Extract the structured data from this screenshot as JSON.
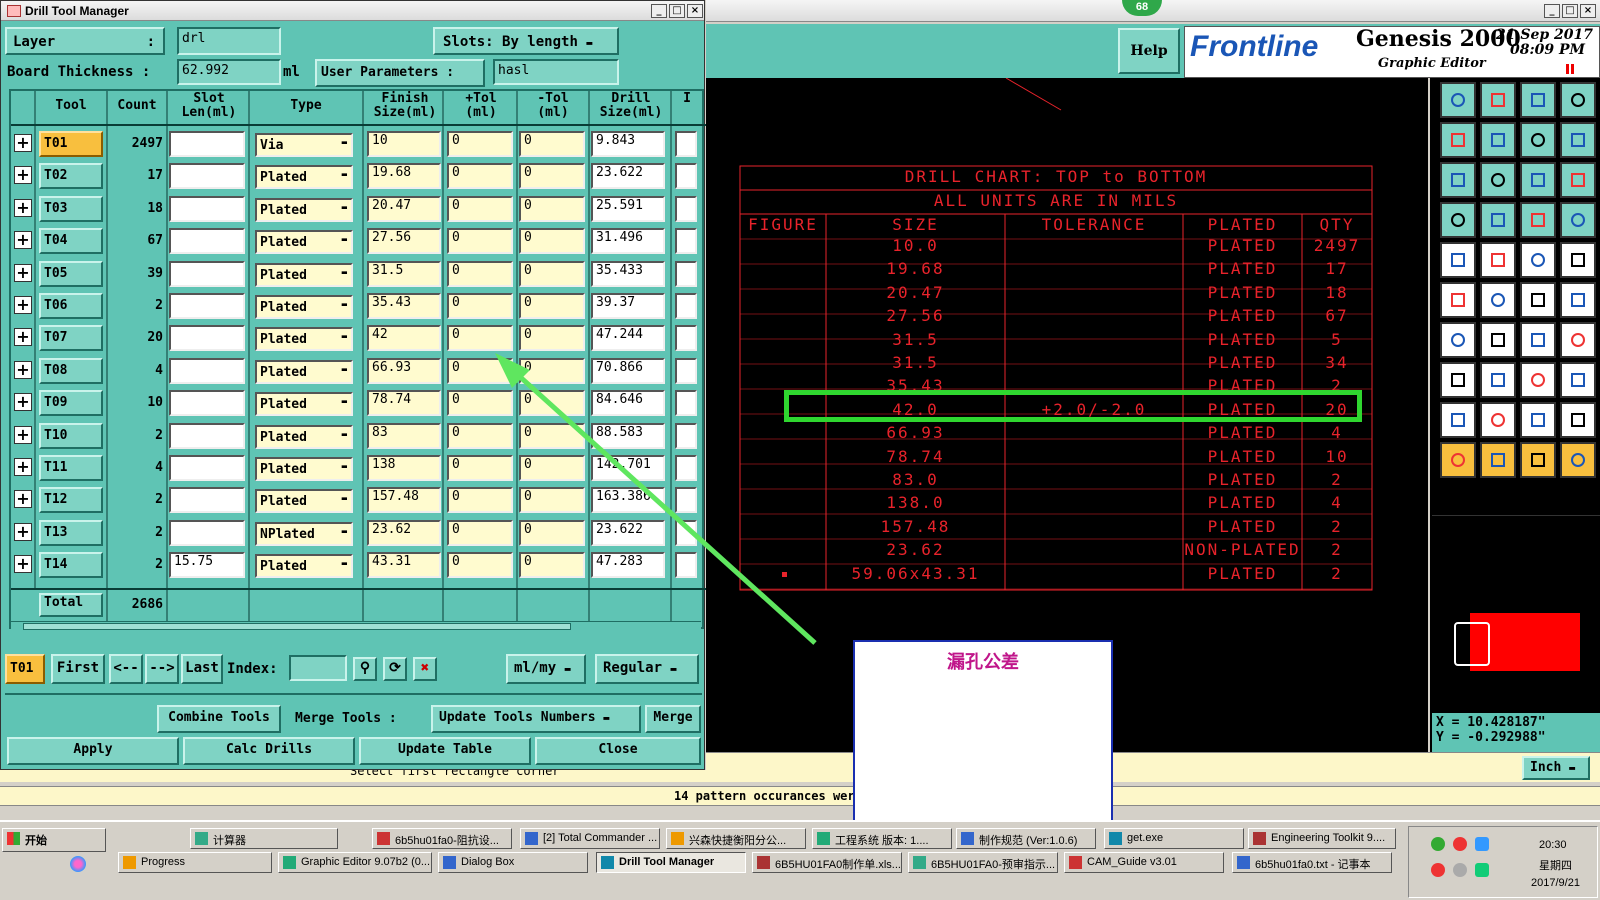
{
  "dtm": {
    "title": "Drill Tool Manager",
    "layer_label": "Layer",
    "layer_sep": ":",
    "layer_value": "drl",
    "slots_label": "Slots:",
    "slots_value": "By length",
    "thickness_label": "Board Thickness :",
    "thickness_value": "62.992",
    "thickness_unit": "ml",
    "user_params_label": "User Parameters :",
    "user_params_value": "hasl",
    "headers": {
      "tool": "Tool",
      "count": "Count",
      "slot": "Slot Len(ml)",
      "type": "Type",
      "finish": "Finish Size(ml)",
      "ptol": "+Tol (ml)",
      "ntol": "-Tol (ml)",
      "drill": "Drill Size(ml)",
      "extra": "I"
    },
    "rows": [
      {
        "tool": "T01",
        "count": "2497",
        "slot": "",
        "type": "Via",
        "finish": "10",
        "ptol": "0",
        "ntol": "0",
        "drill": "9.843"
      },
      {
        "tool": "T02",
        "count": "17",
        "slot": "",
        "type": "Plated",
        "finish": "19.68",
        "ptol": "0",
        "ntol": "0",
        "drill": "23.622"
      },
      {
        "tool": "T03",
        "count": "18",
        "slot": "",
        "type": "Plated",
        "finish": "20.47",
        "ptol": "0",
        "ntol": "0",
        "drill": "25.591"
      },
      {
        "tool": "T04",
        "count": "67",
        "slot": "",
        "type": "Plated",
        "finish": "27.56",
        "ptol": "0",
        "ntol": "0",
        "drill": "31.496"
      },
      {
        "tool": "T05",
        "count": "39",
        "slot": "",
        "type": "Plated",
        "finish": "31.5",
        "ptol": "0",
        "ntol": "0",
        "drill": "35.433"
      },
      {
        "tool": "T06",
        "count": "2",
        "slot": "",
        "type": "Plated",
        "finish": "35.43",
        "ptol": "0",
        "ntol": "0",
        "drill": "39.37"
      },
      {
        "tool": "T07",
        "count": "20",
        "slot": "",
        "type": "Plated",
        "finish": "42",
        "ptol": "0",
        "ntol": "0",
        "drill": "47.244"
      },
      {
        "tool": "T08",
        "count": "4",
        "slot": "",
        "type": "Plated",
        "finish": "66.93",
        "ptol": "0",
        "ntol": "0",
        "drill": "70.866"
      },
      {
        "tool": "T09",
        "count": "10",
        "slot": "",
        "type": "Plated",
        "finish": "78.74",
        "ptol": "0",
        "ntol": "0",
        "drill": "84.646"
      },
      {
        "tool": "T10",
        "count": "2",
        "slot": "",
        "type": "Plated",
        "finish": "83",
        "ptol": "0",
        "ntol": "0",
        "drill": "88.583"
      },
      {
        "tool": "T11",
        "count": "4",
        "slot": "",
        "type": "Plated",
        "finish": "138",
        "ptol": "0",
        "ntol": "0",
        "drill": "142.701"
      },
      {
        "tool": "T12",
        "count": "2",
        "slot": "",
        "type": "Plated",
        "finish": "157.48",
        "ptol": "0",
        "ntol": "0",
        "drill": "163.386"
      },
      {
        "tool": "T13",
        "count": "2",
        "slot": "",
        "type": "NPlated",
        "finish": "23.62",
        "ptol": "0",
        "ntol": "0",
        "drill": "23.622"
      },
      {
        "tool": "T14",
        "count": "2",
        "slot": "15.75",
        "type": "Plated",
        "finish": "43.31",
        "ptol": "0",
        "ntol": "0",
        "drill": "47.283"
      }
    ],
    "total_label": "Total",
    "total_value": "2686",
    "nav": {
      "current": "T01",
      "first": "First",
      "prev": "<--",
      "next": "-->",
      "last": "Last",
      "index_label": "Index:",
      "units": "ml/my",
      "mode": "Regular"
    },
    "actions": {
      "combine": "Combine Tools",
      "merge_label": "Merge Tools :",
      "update_numbers": "Update Tools Numbers",
      "merge": "Merge",
      "apply": "Apply",
      "calc": "Calc Drills",
      "update_table": "Update Table",
      "close": "Close"
    }
  },
  "genesis": {
    "help": "Help",
    "brand": "Frontline",
    "product": "Genesis 2000",
    "subtitle": "Graphic Editor",
    "date": "21 Sep 2017",
    "time": "08:09 PM",
    "badge": "68",
    "coord_x": "X =  10.428187\"",
    "coord_y": "Y = -0.292988\"",
    "units": "Inch",
    "status_msg": "Select first rectangle corner",
    "pattern_msg": "14 pattern occurances were"
  },
  "chart": {
    "title1": "DRILL CHART: TOP to BOTTOM",
    "title2": "ALL UNITS ARE IN MILS",
    "headers": [
      "FIGURE",
      "SIZE",
      "TOLERANCE",
      "PLATED",
      "QTY"
    ],
    "rows": [
      {
        "size": "10.0",
        "tol": "",
        "plated": "PLATED",
        "qty": "2497"
      },
      {
        "size": "19.68",
        "tol": "",
        "plated": "PLATED",
        "qty": "17"
      },
      {
        "size": "20.47",
        "tol": "",
        "plated": "PLATED",
        "qty": "18"
      },
      {
        "size": "27.56",
        "tol": "",
        "plated": "PLATED",
        "qty": "67"
      },
      {
        "size": "31.5",
        "tol": "",
        "plated": "PLATED",
        "qty": "5"
      },
      {
        "size": "31.5",
        "tol": "",
        "plated": "PLATED",
        "qty": "34"
      },
      {
        "size": "35.43",
        "tol": "",
        "plated": "PLATED",
        "qty": "2"
      },
      {
        "size": "42.0",
        "tol": "+2.0/-2.0",
        "plated": "PLATED",
        "qty": "20"
      },
      {
        "size": "66.93",
        "tol": "",
        "plated": "PLATED",
        "qty": "4"
      },
      {
        "size": "78.74",
        "tol": "",
        "plated": "PLATED",
        "qty": "10"
      },
      {
        "size": "83.0",
        "tol": "",
        "plated": "PLATED",
        "qty": "2"
      },
      {
        "size": "138.0",
        "tol": "",
        "plated": "PLATED",
        "qty": "4"
      },
      {
        "size": "157.48",
        "tol": "",
        "plated": "PLATED",
        "qty": "2"
      },
      {
        "size": "23.62",
        "tol": "",
        "plated": "NON-PLATED",
        "qty": "2"
      },
      {
        "size": "59.06x43.31",
        "tol": "",
        "plated": "PLATED",
        "qty": "2"
      }
    ]
  },
  "annotation": {
    "text": "漏孔公差"
  },
  "taskbar": {
    "start": "开始",
    "row1": [
      "计算器",
      "6b5hu01fa0-阻抗设...",
      "[2] Total Commander ...",
      "兴森快捷衡阳分公...",
      "工程系统  版本: 1....",
      "制作规范 (Ver:1.0.6)",
      "get.exe",
      "Engineering Toolkit 9...."
    ],
    "row2": [
      "Progress",
      "Graphic Editor 9.07b2 (0...",
      "Dialog Box",
      "Drill Tool Manager",
      "6B5HU01FA0制作单.xls...",
      "6B5HU01FA0-预审指示...",
      "CAM_Guide v3.01",
      "6b5hu01fa0.txt - 记事本"
    ],
    "clock_time": "20:30",
    "clock_day": "星期四",
    "clock_date": "2017/9/21"
  },
  "colors": {
    "accent_green": "#2fd62f",
    "chart_red": "#e8232b",
    "dialog_teal": "#5fc4b4",
    "tool_orange": "#f8bf3e"
  }
}
